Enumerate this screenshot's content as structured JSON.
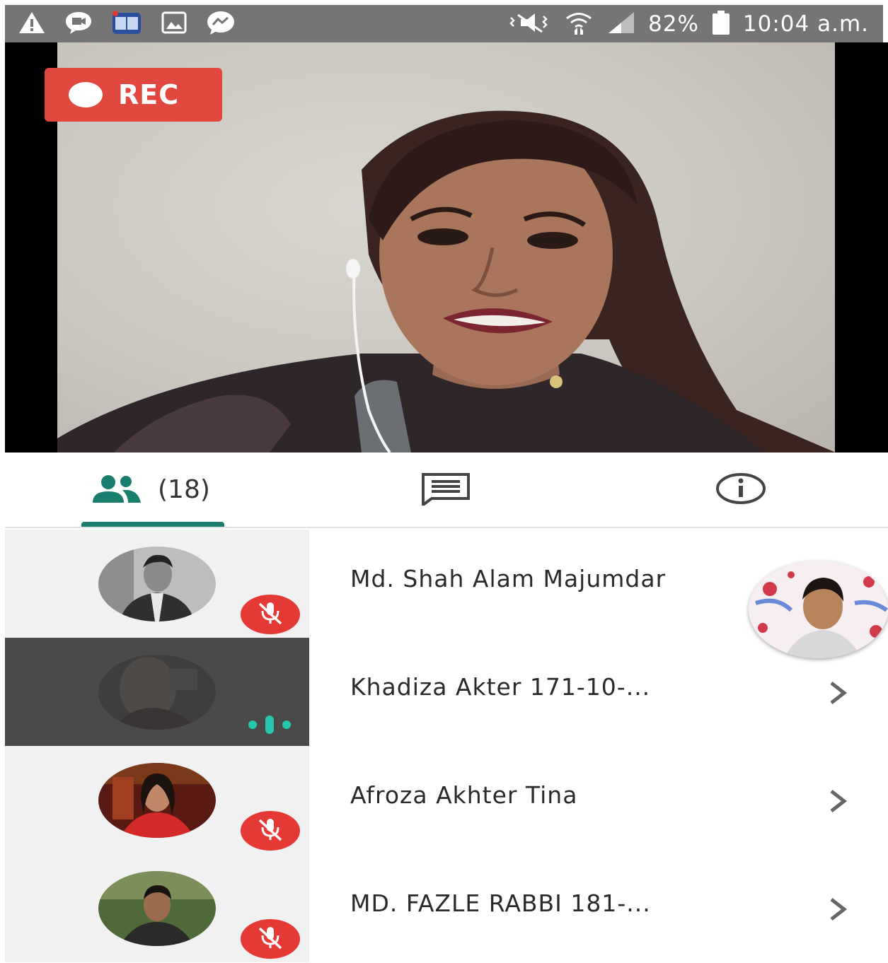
{
  "status_bar": {
    "battery": "82%",
    "time": "10:04 a.m."
  },
  "video": {
    "rec_label": "REC"
  },
  "tabs": {
    "participants_count": "(18)"
  },
  "participants": [
    {
      "name": "Md. Shah Alam Majumdar",
      "muted": true,
      "active": false
    },
    {
      "name": "Khadiza Akter 171-10-...",
      "muted": false,
      "active": true
    },
    {
      "name": "Afroza Akhter Tina",
      "muted": true,
      "active": false
    },
    {
      "name": "MD. FAZLE RABBI 181-...",
      "muted": true,
      "active": false
    }
  ],
  "icons": {
    "status_left": [
      "warning-icon",
      "video-chat-icon",
      "reader-app-icon",
      "image-icon",
      "messenger-icon"
    ],
    "status_right": [
      "vibrate-icon",
      "wifi-icon",
      "signal-icon",
      "battery-icon"
    ],
    "tabs": [
      "people-icon",
      "chat-icon",
      "info-icon"
    ]
  },
  "colors": {
    "status_bar": "#757575",
    "rec_badge": "#e0473f",
    "tab_accent": "#1a7e6e",
    "mute_badge": "#e53935",
    "active_row": "#4a4a4a",
    "speaking_indicator": "#26c6b0"
  }
}
